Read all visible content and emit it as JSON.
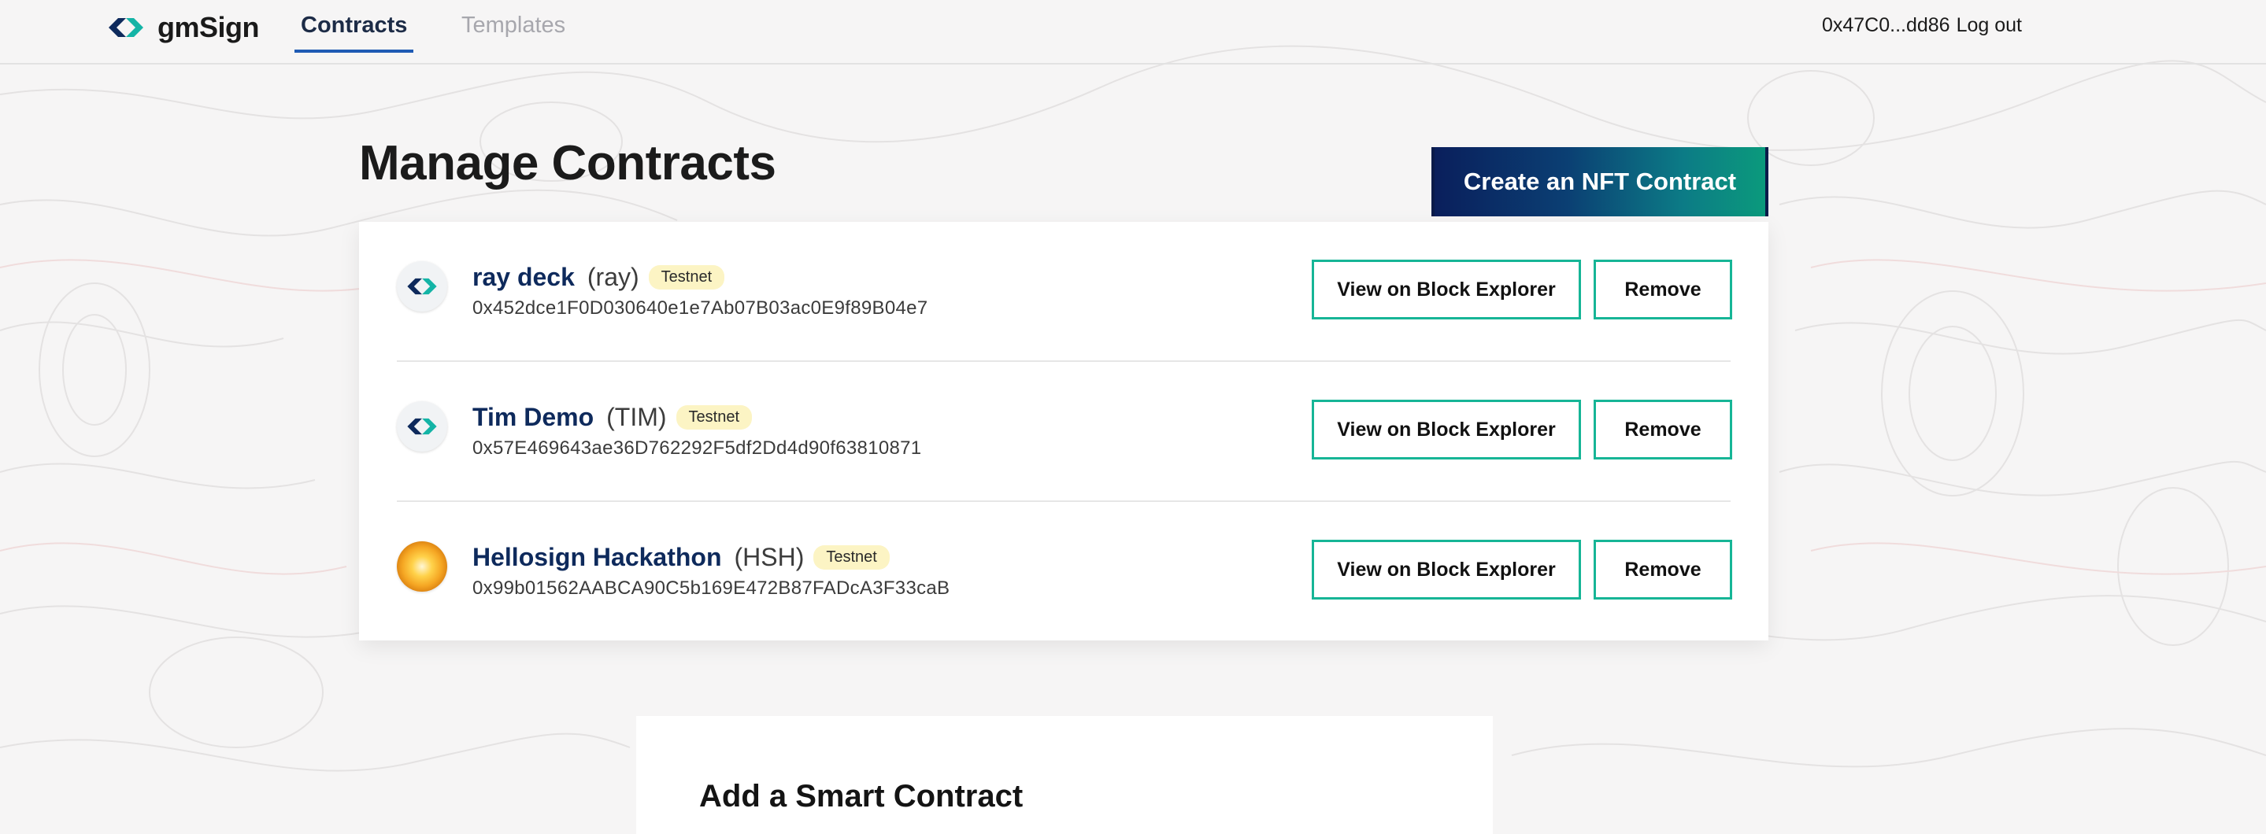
{
  "app": {
    "brand": "gmSign",
    "nav": [
      {
        "label": "Contracts",
        "active": true
      },
      {
        "label": "Templates",
        "active": false
      }
    ],
    "account": {
      "address": "0x47C0...dd86",
      "logout_label": "Log out"
    }
  },
  "page": {
    "title": "Manage Contracts",
    "create_button": "Create an NFT Contract"
  },
  "contracts": [
    {
      "name": "ray deck",
      "symbol": "(ray)",
      "network": "Testnet",
      "address": "0x452dce1F0D030640e1e7Ab07B03ac0E9f89B04e7",
      "icon": "gmsign-logo-icon",
      "explorer_label": "View on Block Explorer",
      "remove_label": "Remove"
    },
    {
      "name": "Tim Demo",
      "symbol": "(TIM)",
      "network": "Testnet",
      "address": "0x57E469643ae36D762292F5df2Dd4d90f63810871",
      "icon": "gmsign-logo-icon",
      "explorer_label": "View on Block Explorer",
      "remove_label": "Remove"
    },
    {
      "name": "Hellosign Hackathon",
      "symbol": "(HSH)",
      "network": "Testnet",
      "address": "0x99b01562AABCA90C5b169E472B87FADcA3F33caB",
      "icon": "sun-orb-icon",
      "explorer_label": "View on Block Explorer",
      "remove_label": "Remove"
    }
  ],
  "add_section": {
    "title": "Add a Smart Contract"
  },
  "colors": {
    "accent_teal": "#16b596",
    "brand_navy": "#0e2a5c",
    "active_tab": "#1f5bb4",
    "badge_bg": "#fcf4c4"
  }
}
